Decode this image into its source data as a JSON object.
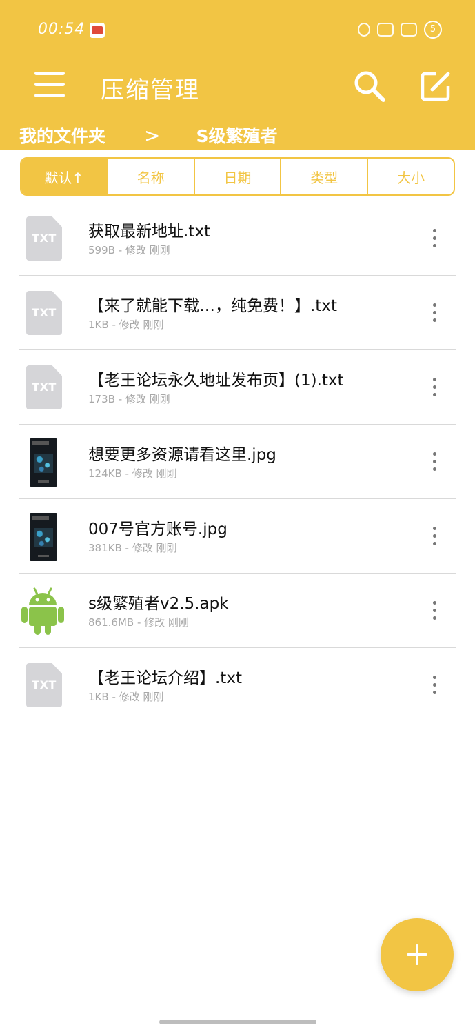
{
  "status_bar": {
    "time": "00:54",
    "battery": "5"
  },
  "app_bar": {
    "title": "压缩管理",
    "menu_icon": "hamburger-menu-icon",
    "search_icon": "search-icon",
    "edit_icon": "edit-icon",
    "accent_color": "#f2c544"
  },
  "breadcrumb": {
    "root": "我的文件夹",
    "separator": ">",
    "current": "S级繁殖者"
  },
  "sort_tabs": [
    {
      "label": "默认↑"
    },
    {
      "label": "名称"
    },
    {
      "label": "日期"
    },
    {
      "label": "类型"
    },
    {
      "label": "大小"
    }
  ],
  "files": [
    {
      "name": "获取最新地址.txt",
      "meta": "599B - 修改 刚刚",
      "icon": "txt-file-icon"
    },
    {
      "name": "【来了就能下载…，纯免费！】.txt",
      "meta": "1KB - 修改 刚刚",
      "icon": "txt-file-icon"
    },
    {
      "name": "【老王论坛永久地址发布页】(1).txt",
      "meta": "173B - 修改 刚刚",
      "icon": "txt-file-icon"
    },
    {
      "name": "想要更多资源请看这里.jpg",
      "meta": "124KB - 修改 刚刚",
      "icon": "image-thumbnail"
    },
    {
      "name": "007号官方账号.jpg",
      "meta": "381KB - 修改 刚刚",
      "icon": "image-thumbnail"
    },
    {
      "name": "s级繁殖者v2.5.apk",
      "meta": "861.6MB - 修改 刚刚",
      "icon": "android-apk-icon"
    },
    {
      "name": "【老王论坛介绍】.txt",
      "meta": "1KB - 修改 刚刚",
      "icon": "txt-file-icon"
    }
  ],
  "txt_badge": "TXT",
  "fab": {
    "icon": "plus-icon"
  }
}
